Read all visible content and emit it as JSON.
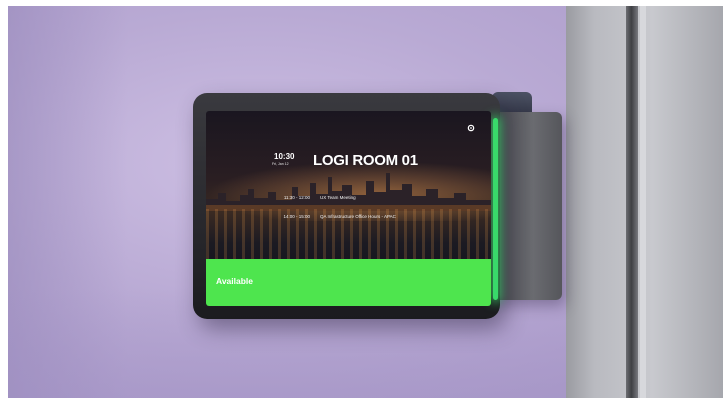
{
  "display": {
    "clock_time": "10:30",
    "clock_date": "Fri, Jan 12",
    "room_name": "LOGI ROOM 01",
    "meetings": [
      {
        "time": "11:30 - 12:00",
        "title": "UX Team Meeting"
      },
      {
        "time": "14:00 - 15:00",
        "title": "QA Infrastructure Office Hours - APAC"
      }
    ],
    "status": "Available",
    "status_color": "#4ee54e",
    "led_color": "#39d96a"
  }
}
